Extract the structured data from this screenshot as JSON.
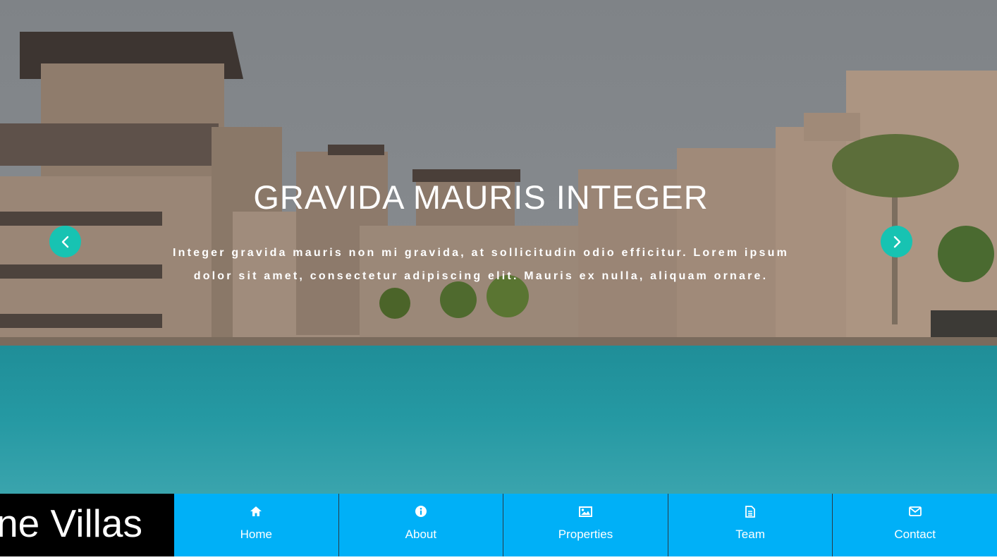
{
  "hero": {
    "title": "GRAVIDA MAURIS INTEGER",
    "text_line1": "Integer gravida mauris non mi gravida, at sollicitudin odio efficitur. Lorem ipsum",
    "text_line2": "dolor sit amet, consectetur adipiscing elit. Mauris ex nulla, aliquam ornare.",
    "prev_icon": "chevron-left-icon",
    "next_icon": "chevron-right-icon"
  },
  "brand": {
    "text": "ne Villas"
  },
  "nav": {
    "items": [
      {
        "label": "Home",
        "icon": "home-icon"
      },
      {
        "label": "About",
        "icon": "info-icon"
      },
      {
        "label": "Properties",
        "icon": "image-icon"
      },
      {
        "label": "Team",
        "icon": "document-icon"
      },
      {
        "label": "Contact",
        "icon": "envelope-icon"
      }
    ]
  },
  "colors": {
    "nav_bg": "#00b0f7",
    "arrow_bg": "#17c3b2",
    "brand_bg": "#000000"
  }
}
